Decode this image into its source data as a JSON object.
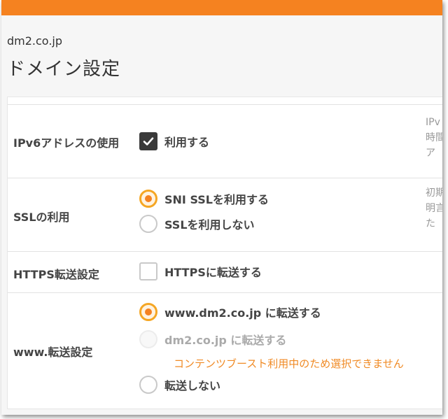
{
  "header": {
    "domain": "dm2.co.jp",
    "title": "ドメイン設定"
  },
  "settings": {
    "ipv6": {
      "label": "IPv6アドレスの使用",
      "option": "利用する",
      "checked": true,
      "help": [
        "IPv",
        "時間",
        "ア "
      ]
    },
    "ssl": {
      "label": "SSLの利用",
      "options": [
        "SNI SSLを利用する",
        "SSLを利用しない"
      ],
      "selected": "SNI SSLを利用する",
      "help": [
        "初期",
        "明言",
        "た "
      ]
    },
    "https": {
      "label": "HTTPS転送設定",
      "option": "HTTPSに転送する",
      "checked": false
    },
    "www": {
      "label": "www.転送設定",
      "options": [
        "www.dm2.co.jp に転送する",
        "dm2.co.jp に転送する",
        "転送しない"
      ],
      "selected": "www.dm2.co.jp に転送する",
      "disabled": "dm2.co.jp に転送する",
      "warning": "コンテンツブースト利用中のため選択できません"
    }
  },
  "colors": {
    "accent": "#f58220",
    "warning": "#f08a24",
    "checkbox": "#3a3a3a"
  }
}
